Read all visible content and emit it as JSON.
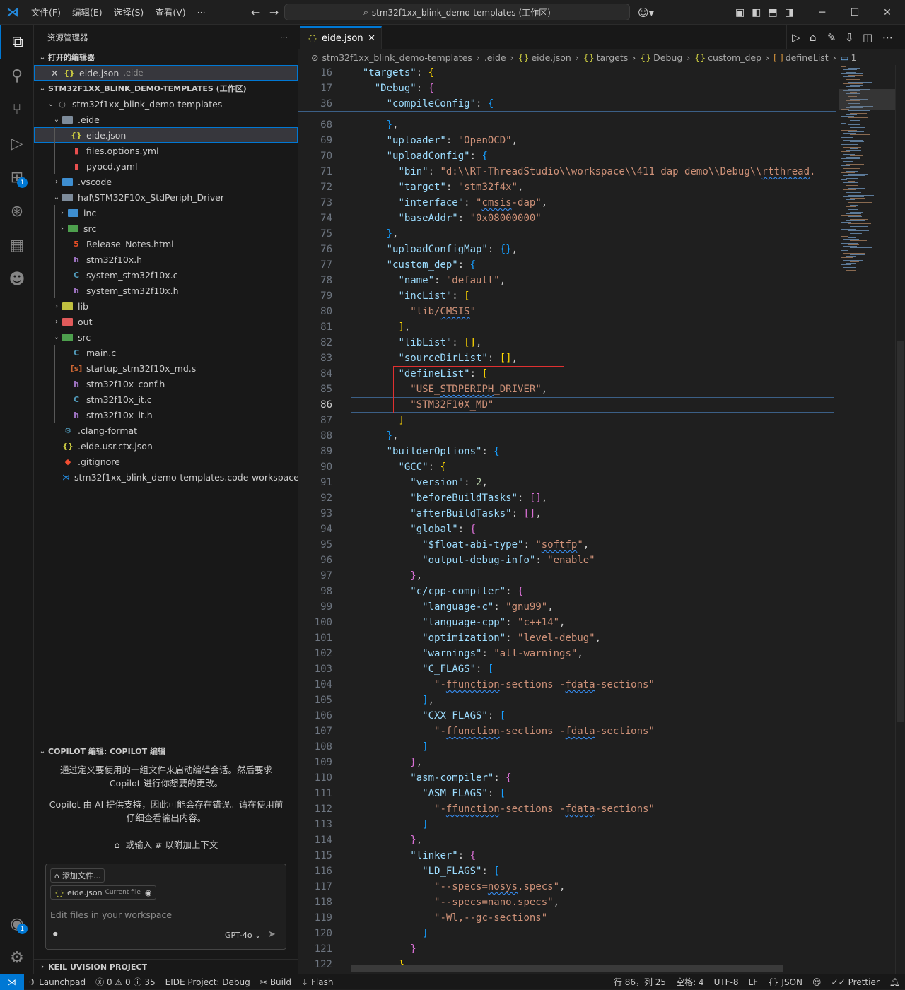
{
  "menu": {
    "items": [
      "文件(F)",
      "编辑(E)",
      "选择(S)",
      "查看(V)",
      "···"
    ]
  },
  "command_center": {
    "title": "stm32f1xx_blink_demo-templates (工作区)"
  },
  "activity_bar": {
    "extensions_badge": "1",
    "accounts_badge": "1"
  },
  "sidebar": {
    "title": "资源管理器",
    "more": "···",
    "open_editors_header": "打开的编辑器",
    "open_editor": {
      "name": "eide.json",
      "path": ".eide"
    },
    "workspace_header": "STM32F1XX_BLINK_DEMO-TEMPLATES (工作区)",
    "tree": [
      {
        "label": "stm32f1xx_blink_demo-templates"
      },
      {
        "label": ".eide"
      },
      {
        "label": "eide.json"
      },
      {
        "label": "files.options.yml"
      },
      {
        "label": "pyocd.yaml"
      },
      {
        "label": ".vscode"
      },
      {
        "label": "hal\\STM32F10x_StdPeriph_Driver"
      },
      {
        "label": "inc"
      },
      {
        "label": "src"
      },
      {
        "label": "Release_Notes.html"
      },
      {
        "label": "stm32f10x.h"
      },
      {
        "label": "system_stm32f10x.c"
      },
      {
        "label": "system_stm32f10x.h"
      },
      {
        "label": "lib"
      },
      {
        "label": "out"
      },
      {
        "label": "src"
      },
      {
        "label": "main.c"
      },
      {
        "label": "startup_stm32f10x_md.s"
      },
      {
        "label": "stm32f10x_conf.h"
      },
      {
        "label": "stm32f10x_it.c"
      },
      {
        "label": "stm32f10x_it.h"
      },
      {
        "label": ".clang-format"
      },
      {
        "label": ".eide.usr.ctx.json"
      },
      {
        "label": ".gitignore"
      },
      {
        "label": "stm32f1xx_blink_demo-templates.code-workspace"
      }
    ],
    "copilot": {
      "header": "COPILOT 编辑: COPILOT 编辑",
      "intro": "通过定义要使用的一组文件来启动编辑会话。然后要求 Copilot 进行你想要的更改。",
      "disclaimer": "Copilot 由 AI 提供支持，因此可能会存在错误。请在使用前仔细查看输出内容。",
      "attach_hint": "或输入 # 以附加上下文",
      "add_files": "添加文件...",
      "current_file_name": "eide.json",
      "current_file_tag": "Current file",
      "placeholder": "Edit files in your workspace",
      "model": "GPT-4o"
    },
    "keil_header": "KEIL UVISION PROJECT"
  },
  "tab": {
    "label": "eide.json"
  },
  "breadcrumb": [
    "stm32f1xx_blink_demo-templates",
    ".eide",
    "eide.json",
    "targets",
    "Debug",
    "custom_dep",
    "defineList",
    "1"
  ],
  "editor": {
    "sticky": [
      {
        "ln": "16",
        "code": "  \"targets\": {"
      },
      {
        "ln": "17",
        "code": "    \"Debug\": {"
      },
      {
        "ln": "36",
        "code": "      \"compileConfig\": {"
      }
    ],
    "lines": [
      {
        "ln": "68",
        "code": "      },"
      },
      {
        "ln": "69",
        "code": "      \"uploader\": \"OpenOCD\","
      },
      {
        "ln": "70",
        "code": "      \"uploadConfig\": {"
      },
      {
        "ln": "71",
        "code": "        \"bin\": \"d:\\\\RT-ThreadStudio\\\\workspace\\\\411_dap_demo\\\\Debug\\\\rtthread."
      },
      {
        "ln": "72",
        "code": "        \"target\": \"stm32f4x\","
      },
      {
        "ln": "73",
        "code": "        \"interface\": \"cmsis-dap\","
      },
      {
        "ln": "74",
        "code": "        \"baseAddr\": \"0x08000000\""
      },
      {
        "ln": "75",
        "code": "      },"
      },
      {
        "ln": "76",
        "code": "      \"uploadConfigMap\": {},"
      },
      {
        "ln": "77",
        "code": "      \"custom_dep\": {"
      },
      {
        "ln": "78",
        "code": "        \"name\": \"default\","
      },
      {
        "ln": "79",
        "code": "        \"incList\": ["
      },
      {
        "ln": "80",
        "code": "          \"lib/CMSIS\""
      },
      {
        "ln": "81",
        "code": "        ],"
      },
      {
        "ln": "82",
        "code": "        \"libList\": [],"
      },
      {
        "ln": "83",
        "code": "        \"sourceDirList\": [],"
      },
      {
        "ln": "84",
        "code": "        \"defineList\": ["
      },
      {
        "ln": "85",
        "code": "          \"USE_STDPERIPH_DRIVER\","
      },
      {
        "ln": "86",
        "code": "          \"STM32F10X_MD\""
      },
      {
        "ln": "87",
        "code": "        ]"
      },
      {
        "ln": "88",
        "code": "      },"
      },
      {
        "ln": "89",
        "code": "      \"builderOptions\": {"
      },
      {
        "ln": "90",
        "code": "        \"GCC\": {"
      },
      {
        "ln": "91",
        "code": "          \"version\": 2,"
      },
      {
        "ln": "92",
        "code": "          \"beforeBuildTasks\": [],"
      },
      {
        "ln": "93",
        "code": "          \"afterBuildTasks\": [],"
      },
      {
        "ln": "94",
        "code": "          \"global\": {"
      },
      {
        "ln": "95",
        "code": "            \"$float-abi-type\": \"softfp\","
      },
      {
        "ln": "96",
        "code": "            \"output-debug-info\": \"enable\""
      },
      {
        "ln": "97",
        "code": "          },"
      },
      {
        "ln": "98",
        "code": "          \"c/cpp-compiler\": {"
      },
      {
        "ln": "99",
        "code": "            \"language-c\": \"gnu99\","
      },
      {
        "ln": "100",
        "code": "            \"language-cpp\": \"c++14\","
      },
      {
        "ln": "101",
        "code": "            \"optimization\": \"level-debug\","
      },
      {
        "ln": "102",
        "code": "            \"warnings\": \"all-warnings\","
      },
      {
        "ln": "103",
        "code": "            \"C_FLAGS\": ["
      },
      {
        "ln": "104",
        "code": "              \"-ffunction-sections -fdata-sections\""
      },
      {
        "ln": "105",
        "code": "            ],"
      },
      {
        "ln": "106",
        "code": "            \"CXX_FLAGS\": ["
      },
      {
        "ln": "107",
        "code": "              \"-ffunction-sections -fdata-sections\""
      },
      {
        "ln": "108",
        "code": "            ]"
      },
      {
        "ln": "109",
        "code": "          },"
      },
      {
        "ln": "110",
        "code": "          \"asm-compiler\": {"
      },
      {
        "ln": "111",
        "code": "            \"ASM_FLAGS\": ["
      },
      {
        "ln": "112",
        "code": "              \"-ffunction-sections -fdata-sections\""
      },
      {
        "ln": "113",
        "code": "            ]"
      },
      {
        "ln": "114",
        "code": "          },"
      },
      {
        "ln": "115",
        "code": "          \"linker\": {"
      },
      {
        "ln": "116",
        "code": "            \"LD_FLAGS\": ["
      },
      {
        "ln": "117",
        "code": "              \"--specs=nosys.specs\","
      },
      {
        "ln": "118",
        "code": "              \"--specs=nano.specs\","
      },
      {
        "ln": "119",
        "code": "              \"-Wl,--gc-sections\""
      },
      {
        "ln": "120",
        "code": "            ]"
      },
      {
        "ln": "121",
        "code": "          }"
      },
      {
        "ln": "122",
        "code": "        },"
      }
    ]
  },
  "statusbar": {
    "launchpad": "Launchpad",
    "errors": "0",
    "warnings": "0",
    "infos": "35",
    "eide_project": "EIDE Project: Debug",
    "build": "Build",
    "flash": "Flash",
    "position": "行 86，列 25",
    "spaces": "空格: 4",
    "encoding": "UTF-8",
    "eol": "LF",
    "language": "JSON",
    "prettier": "Prettier"
  }
}
